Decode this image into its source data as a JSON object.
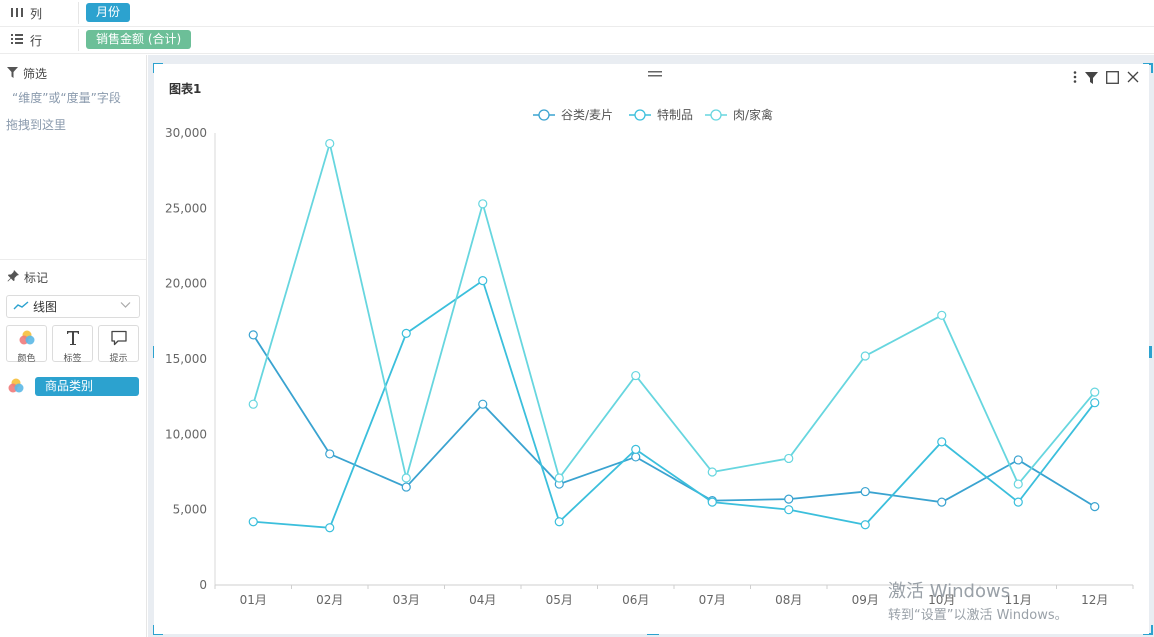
{
  "shelves": {
    "columns": {
      "label": "列",
      "pill": "月份"
    },
    "rows": {
      "label": "行",
      "pill": "销售金额 (合计)"
    }
  },
  "filter": {
    "title": "筛选",
    "hint_line1": "“维度”或“度量”字段",
    "hint_line2": "拖拽到这里"
  },
  "marks": {
    "title": "标记",
    "type_selected": "线图",
    "buttons": [
      {
        "label": "颜色",
        "icon": "color-icon"
      },
      {
        "label": "标签",
        "icon": "text-icon"
      },
      {
        "label": "提示",
        "icon": "tooltip-icon"
      }
    ],
    "color_field": "商品类别"
  },
  "chart_card": {
    "title": "图表1",
    "tools": [
      "more-icon",
      "filter-icon",
      "maximize-icon",
      "close-icon"
    ]
  },
  "watermark": {
    "line1": "激活 Windows",
    "line2": "转到“设置”以激活 Windows。"
  },
  "colors": {
    "accent": "#2ca2cf",
    "pill_green": "#6cbf98"
  },
  "chart_data": {
    "type": "line",
    "categories": [
      "01月",
      "02月",
      "03月",
      "04月",
      "05月",
      "06月",
      "07月",
      "08月",
      "09月",
      "10月",
      "11月",
      "12月"
    ],
    "ylim": [
      0,
      30000
    ],
    "yticks": [
      0,
      5000,
      10000,
      15000,
      20000,
      25000,
      30000
    ],
    "ytick_labels": [
      "0",
      "5,000",
      "10,000",
      "15,000",
      "20,000",
      "25,000",
      "30,000"
    ],
    "legend_position": "top-center",
    "grid": false,
    "series": [
      {
        "name": "谷类/麦片",
        "color": "#3aa3d0",
        "values": [
          16600,
          8700,
          6500,
          12000,
          6700,
          8500,
          5600,
          5700,
          6200,
          5500,
          8300,
          5200
        ]
      },
      {
        "name": "特制品",
        "color": "#3bbfdc",
        "values": [
          4200,
          3800,
          16700,
          20200,
          4200,
          9000,
          5500,
          5000,
          4000,
          9500,
          5500,
          12100
        ]
      },
      {
        "name": "肉/家禽",
        "color": "#67d6df",
        "values": [
          12000,
          29300,
          7100,
          25300,
          7100,
          13900,
          7500,
          8400,
          15200,
          17900,
          6700,
          12800
        ]
      }
    ]
  }
}
